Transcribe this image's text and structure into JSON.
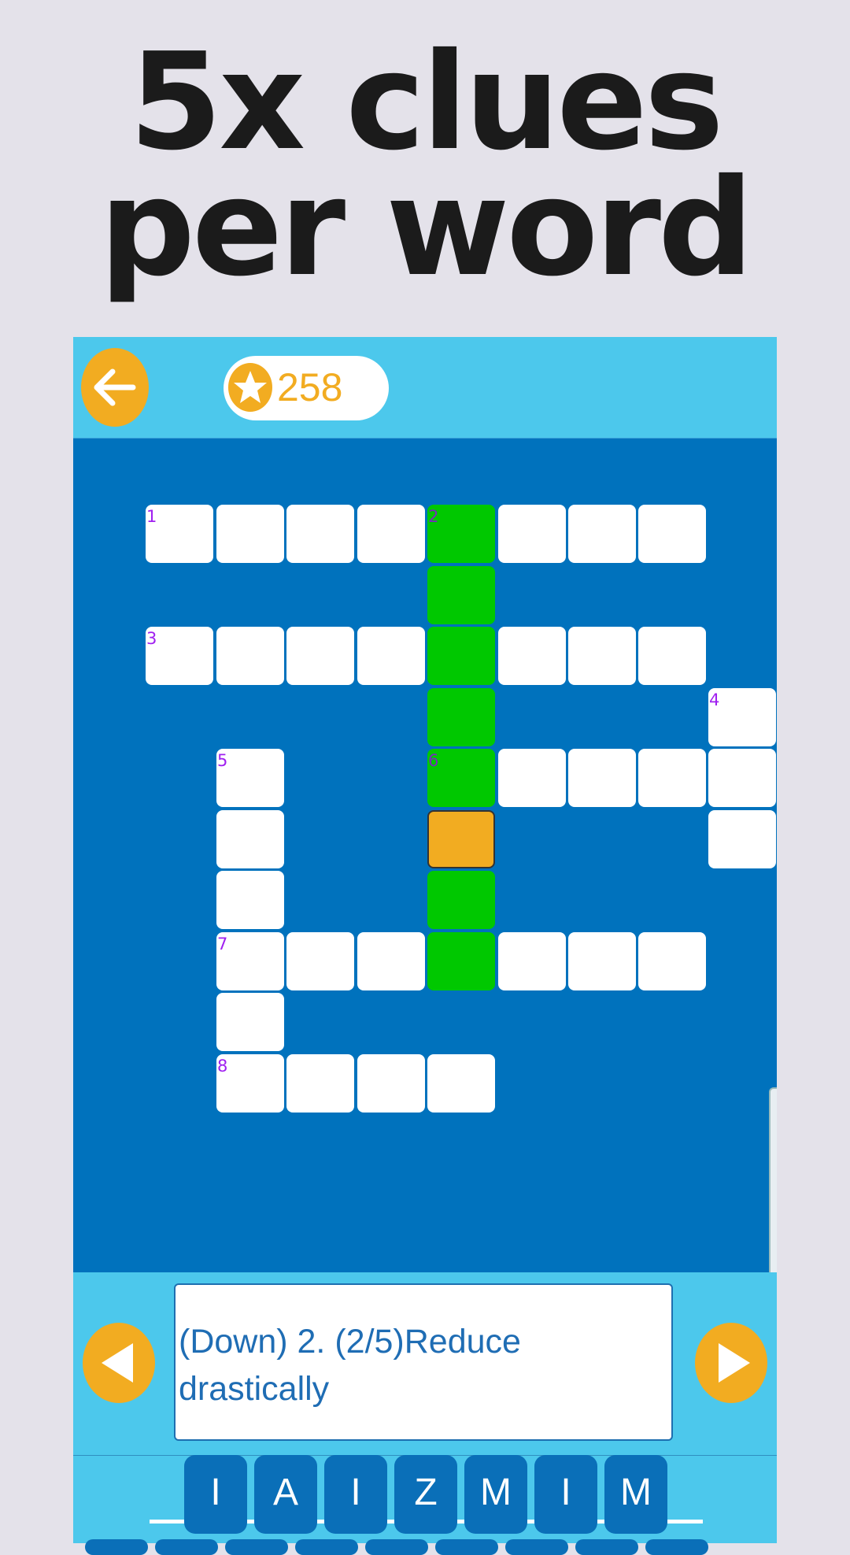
{
  "headline": {
    "line1": "5x clues",
    "line2": "per word"
  },
  "topbar": {
    "coins": "258"
  },
  "board": {
    "cells": [
      {
        "id": "r0c0",
        "num": "1",
        "state": "empty"
      },
      {
        "id": "r0c4",
        "num": "2",
        "state": "highlight"
      },
      {
        "id": "r2c0",
        "num": "3",
        "state": "empty"
      },
      {
        "id": "r3c8",
        "num": "4",
        "state": "empty"
      },
      {
        "id": "r4c1",
        "num": "5",
        "state": "empty"
      },
      {
        "id": "r4c4",
        "num": "6",
        "state": "highlight"
      },
      {
        "id": "r7c1",
        "num": "7",
        "state": "empty"
      },
      {
        "id": "r9c1",
        "num": "8",
        "state": "empty"
      }
    ]
  },
  "clue": {
    "text": "(Down) 2. (2/5)Reduce drastically"
  },
  "letters": [
    "I",
    "A",
    "I",
    "Z",
    "M",
    "I",
    "M"
  ],
  "colors": {
    "accent": "#f2ac21",
    "board": "#0072bd",
    "highlight": "#00c800",
    "bar": "#4cc8ec"
  },
  "icons": {
    "back": "back-arrow-icon",
    "coin": "star-coin-icon",
    "prev": "triangle-left-icon",
    "next": "triangle-right-icon"
  }
}
